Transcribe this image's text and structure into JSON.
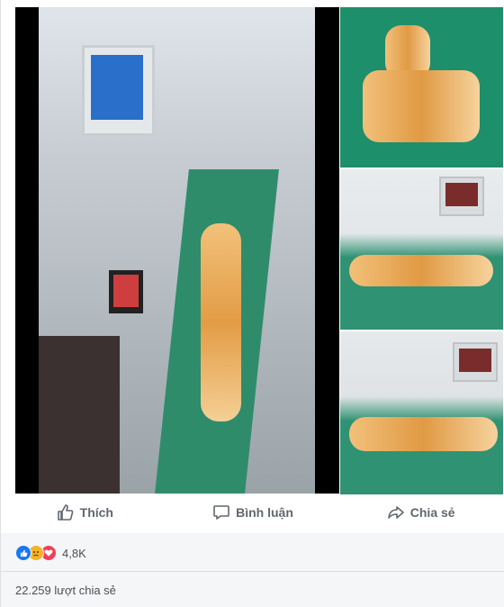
{
  "actions": {
    "like_label": "Thích",
    "comment_label": "Bình luận",
    "share_label": "Chia sẻ"
  },
  "stats": {
    "reaction_count": "4,8K",
    "reactions": [
      "like-icon",
      "sad-icon",
      "love-icon"
    ],
    "share_count": "22.259 lượt chia sẻ"
  },
  "colors": {
    "like": "#1877f2",
    "sad": "#f7b125",
    "love": "#f33e58",
    "action_text": "#606770"
  }
}
